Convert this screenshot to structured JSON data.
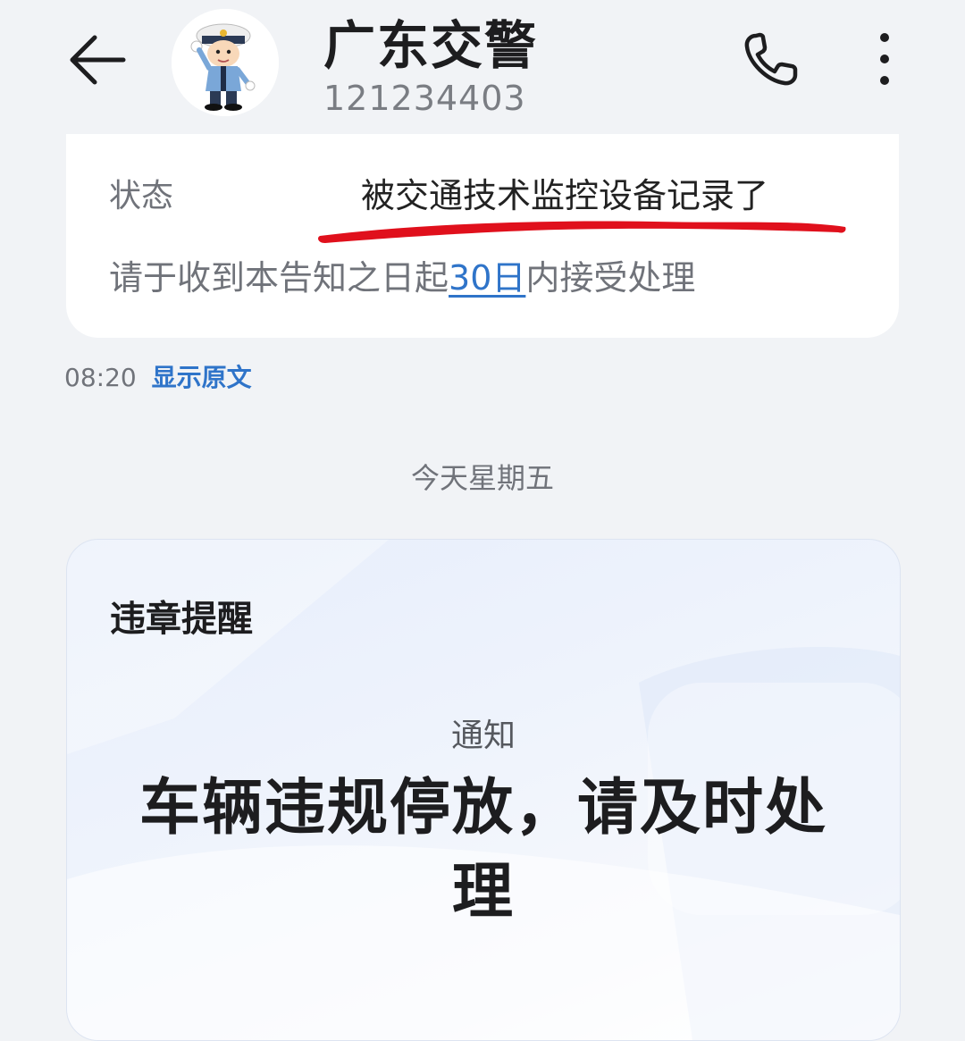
{
  "header": {
    "title": "广东交警",
    "number": "121234403"
  },
  "message_card": {
    "status_label": "状态",
    "status_value": "被交通技术监控设备记录了",
    "notice_prefix": "请于收到本告知之日起",
    "notice_link": "30日",
    "notice_suffix": "内接受处理",
    "underline_color": "#e0101c"
  },
  "message_meta": {
    "time": "08:20",
    "show_original": "显示原文"
  },
  "date_separator": "今天星期五",
  "violation_card": {
    "title": "违章提醒",
    "subtitle": "通知",
    "headline": "车辆违规停放，请及时处理"
  },
  "colors": {
    "accent": "#2f74c9",
    "background": "#f1f3f6"
  },
  "icons": [
    "back-arrow-icon",
    "police-avatar",
    "phone-icon",
    "more-vertical-icon"
  ]
}
